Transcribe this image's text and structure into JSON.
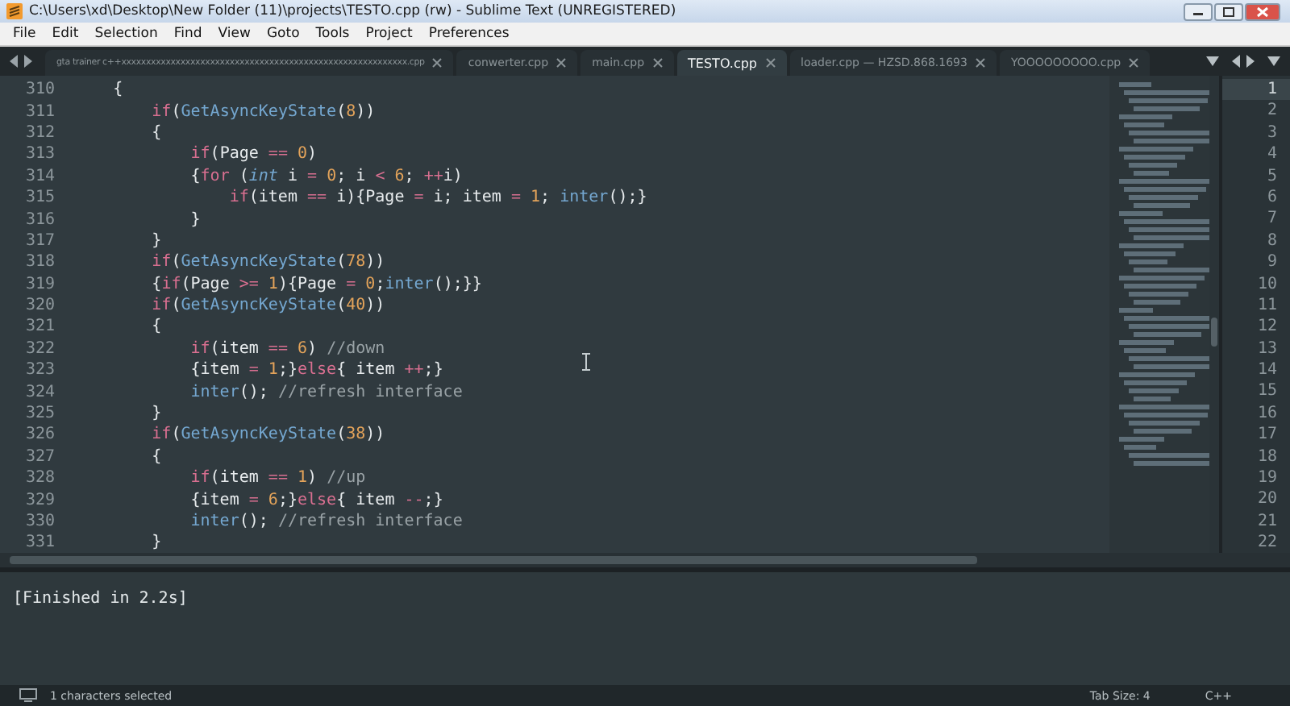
{
  "window": {
    "title": "C:\\Users\\xd\\Desktop\\New Folder (11)\\projects\\TESTO.cpp (rw) - Sublime Text (UNREGISTERED)"
  },
  "menu": [
    "File",
    "Edit",
    "Selection",
    "Find",
    "View",
    "Goto",
    "Tools",
    "Project",
    "Preferences"
  ],
  "tabs": [
    {
      "label": "gta trainer c++xxxxxxxxxxxxxxxxxxxxxxxxxxxxxxxxxxxxxxxxxxxxxxxxxxxxxxxxxx.cpp",
      "selected": false
    },
    {
      "label": "conwerter.cpp",
      "selected": false
    },
    {
      "label": "main.cpp",
      "selected": false
    },
    {
      "label": "TESTO.cpp",
      "selected": true
    },
    {
      "label": "loader.cpp — HZSD.868.1693",
      "selected": false
    },
    {
      "label": "YOOOOOOOOO.cpp",
      "selected": false
    }
  ],
  "editor": {
    "lines": [
      {
        "number": "310",
        "tokens": [
          {
            "text": "    {",
            "kind": "plain"
          }
        ]
      },
      {
        "number": "311",
        "tokens": [
          {
            "text": "        if",
            "kind": "keyword"
          },
          {
            "text": "(",
            "kind": "plain"
          },
          {
            "text": "GetAsyncKeyState",
            "kind": "func"
          },
          {
            "text": "(",
            "kind": "plain"
          },
          {
            "text": "8",
            "kind": "number"
          },
          {
            "text": "))",
            "kind": "plain"
          }
        ]
      },
      {
        "number": "312",
        "tokens": [
          {
            "text": "        {",
            "kind": "plain"
          }
        ]
      },
      {
        "number": "313",
        "tokens": [
          {
            "text": "            if",
            "kind": "keyword"
          },
          {
            "text": "(Page ",
            "kind": "plain"
          },
          {
            "text": "== ",
            "kind": "operator"
          },
          {
            "text": "0",
            "kind": "number"
          },
          {
            "text": ")",
            "kind": "plain"
          }
        ]
      },
      {
        "number": "314",
        "tokens": [
          {
            "text": "            {",
            "kind": "plain"
          },
          {
            "text": "for",
            "kind": "keyword"
          },
          {
            "text": " (",
            "kind": "plain"
          },
          {
            "text": "int",
            "kind": "type"
          },
          {
            "text": " i ",
            "kind": "plain"
          },
          {
            "text": "= ",
            "kind": "operator"
          },
          {
            "text": "0",
            "kind": "number"
          },
          {
            "text": "; i ",
            "kind": "plain"
          },
          {
            "text": "< ",
            "kind": "operator"
          },
          {
            "text": "6",
            "kind": "number"
          },
          {
            "text": "; ",
            "kind": "plain"
          },
          {
            "text": "++",
            "kind": "operator"
          },
          {
            "text": "i)",
            "kind": "plain"
          }
        ]
      },
      {
        "number": "315",
        "tokens": [
          {
            "text": "                if",
            "kind": "keyword"
          },
          {
            "text": "(item ",
            "kind": "plain"
          },
          {
            "text": "==",
            "kind": "operator"
          },
          {
            "text": " i){Page ",
            "kind": "plain"
          },
          {
            "text": "=",
            "kind": "operator"
          },
          {
            "text": " i; item ",
            "kind": "plain"
          },
          {
            "text": "= ",
            "kind": "operator"
          },
          {
            "text": "1",
            "kind": "number"
          },
          {
            "text": "; ",
            "kind": "plain"
          },
          {
            "text": "inter",
            "kind": "func"
          },
          {
            "text": "();}",
            "kind": "plain"
          }
        ]
      },
      {
        "number": "316",
        "tokens": [
          {
            "text": "            }",
            "kind": "plain"
          }
        ]
      },
      {
        "number": "317",
        "tokens": [
          {
            "text": "        }",
            "kind": "plain"
          }
        ]
      },
      {
        "number": "318",
        "tokens": [
          {
            "text": "        if",
            "kind": "keyword"
          },
          {
            "text": "(",
            "kind": "plain"
          },
          {
            "text": "GetAsyncKeyState",
            "kind": "func"
          },
          {
            "text": "(",
            "kind": "plain"
          },
          {
            "text": "78",
            "kind": "number"
          },
          {
            "text": "))",
            "kind": "plain"
          }
        ]
      },
      {
        "number": "319",
        "tokens": [
          {
            "text": "        {",
            "kind": "plain"
          },
          {
            "text": "if",
            "kind": "keyword"
          },
          {
            "text": "(Page ",
            "kind": "plain"
          },
          {
            "text": ">= ",
            "kind": "operator"
          },
          {
            "text": "1",
            "kind": "number"
          },
          {
            "text": "){Page ",
            "kind": "plain"
          },
          {
            "text": "= ",
            "kind": "operator"
          },
          {
            "text": "0",
            "kind": "number"
          },
          {
            "text": ";",
            "kind": "plain"
          },
          {
            "text": "inter",
            "kind": "func"
          },
          {
            "text": "();}}",
            "kind": "plain"
          }
        ]
      },
      {
        "number": "320",
        "tokens": [
          {
            "text": "        if",
            "kind": "keyword"
          },
          {
            "text": "(",
            "kind": "plain"
          },
          {
            "text": "GetAsyncKeyState",
            "kind": "func"
          },
          {
            "text": "(",
            "kind": "plain"
          },
          {
            "text": "40",
            "kind": "number"
          },
          {
            "text": "))",
            "kind": "plain"
          }
        ]
      },
      {
        "number": "321",
        "tokens": [
          {
            "text": "        {",
            "kind": "plain"
          }
        ]
      },
      {
        "number": "322",
        "tokens": [
          {
            "text": "            if",
            "kind": "keyword"
          },
          {
            "text": "(item ",
            "kind": "plain"
          },
          {
            "text": "== ",
            "kind": "operator"
          },
          {
            "text": "6",
            "kind": "number"
          },
          {
            "text": ") ",
            "kind": "plain"
          },
          {
            "text": "//down",
            "kind": "comment"
          }
        ]
      },
      {
        "number": "323",
        "tokens": [
          {
            "text": "            {item ",
            "kind": "plain"
          },
          {
            "text": "= ",
            "kind": "operator"
          },
          {
            "text": "1",
            "kind": "number"
          },
          {
            "text": ";}",
            "kind": "plain"
          },
          {
            "text": "else",
            "kind": "keyword"
          },
          {
            "text": "{ item ",
            "kind": "plain"
          },
          {
            "text": "++",
            "kind": "operator"
          },
          {
            "text": ";}",
            "kind": "plain"
          }
        ]
      },
      {
        "number": "324",
        "tokens": [
          {
            "text": "            inter",
            "kind": "func"
          },
          {
            "text": "(); ",
            "kind": "plain"
          },
          {
            "text": "//refresh interface",
            "kind": "comment"
          }
        ]
      },
      {
        "number": "325",
        "tokens": [
          {
            "text": "        }",
            "kind": "plain"
          }
        ]
      },
      {
        "number": "326",
        "tokens": [
          {
            "text": "        if",
            "kind": "keyword"
          },
          {
            "text": "(",
            "kind": "plain"
          },
          {
            "text": "GetAsyncKeyState",
            "kind": "func"
          },
          {
            "text": "(",
            "kind": "plain"
          },
          {
            "text": "38",
            "kind": "number"
          },
          {
            "text": "))",
            "kind": "plain"
          }
        ]
      },
      {
        "number": "327",
        "tokens": [
          {
            "text": "        {",
            "kind": "plain"
          }
        ]
      },
      {
        "number": "328",
        "tokens": [
          {
            "text": "            if",
            "kind": "keyword"
          },
          {
            "text": "(item ",
            "kind": "plain"
          },
          {
            "text": "== ",
            "kind": "operator"
          },
          {
            "text": "1",
            "kind": "number"
          },
          {
            "text": ") ",
            "kind": "plain"
          },
          {
            "text": "//up",
            "kind": "comment"
          }
        ]
      },
      {
        "number": "329",
        "tokens": [
          {
            "text": "            {item ",
            "kind": "plain"
          },
          {
            "text": "= ",
            "kind": "operator"
          },
          {
            "text": "6",
            "kind": "number"
          },
          {
            "text": ";}",
            "kind": "plain"
          },
          {
            "text": "else",
            "kind": "keyword"
          },
          {
            "text": "{ item ",
            "kind": "plain"
          },
          {
            "text": "--",
            "kind": "operator"
          },
          {
            "text": ";}",
            "kind": "plain"
          }
        ]
      },
      {
        "number": "330",
        "tokens": [
          {
            "text": "            inter",
            "kind": "func"
          },
          {
            "text": "(); ",
            "kind": "plain"
          },
          {
            "text": "//refresh interface",
            "kind": "comment"
          }
        ]
      },
      {
        "number": "331",
        "tokens": [
          {
            "text": "        }",
            "kind": "plain"
          }
        ]
      }
    ]
  },
  "side_pane": {
    "line_numbers": [
      "1",
      "2",
      "3",
      "4",
      "5",
      "6",
      "7",
      "8",
      "9",
      "10",
      "11",
      "12",
      "13",
      "14",
      "15",
      "16",
      "17",
      "18",
      "19",
      "20",
      "21",
      "22"
    ]
  },
  "output": {
    "text": "[Finished in 2.2s]"
  },
  "status_bar": {
    "selection": "1 characters selected",
    "tab_size": "Tab Size: 4",
    "syntax": "C++"
  }
}
